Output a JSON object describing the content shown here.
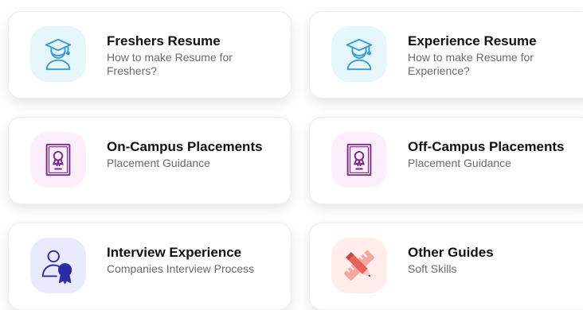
{
  "cards": [
    {
      "title": "Freshers Resume",
      "subtitle": "How to make Resume for Freshers?",
      "icon": "graduate-icon",
      "icon_bg": "#e6f7fb",
      "icon_color": "#3a9cd6"
    },
    {
      "title": "Experience Resume",
      "subtitle": "How to make Resume for Experience?",
      "icon": "graduate-icon",
      "icon_bg": "#e6f7fb",
      "icon_color": "#3a9cd6"
    },
    {
      "title": "On-Campus Placements",
      "subtitle": "Placement Guidance",
      "icon": "certificate-icon",
      "icon_bg": "#fdeefb",
      "icon_color": "#7a2a8a"
    },
    {
      "title": "Off-Campus Placements",
      "subtitle": "Placement Guidance",
      "icon": "certificate-icon",
      "icon_bg": "#fdeefb",
      "icon_color": "#7a2a8a"
    },
    {
      "title": "Interview Experience",
      "subtitle": "Companies Interview Process",
      "icon": "user-award-icon",
      "icon_bg": "#eaeaff",
      "icon_color": "#2d2aa8"
    },
    {
      "title": "Other Guides",
      "subtitle": "Soft Skills",
      "icon": "pencil-ruler-icon",
      "icon_bg": "#ffeceb",
      "icon_color": "#e8625a"
    }
  ]
}
